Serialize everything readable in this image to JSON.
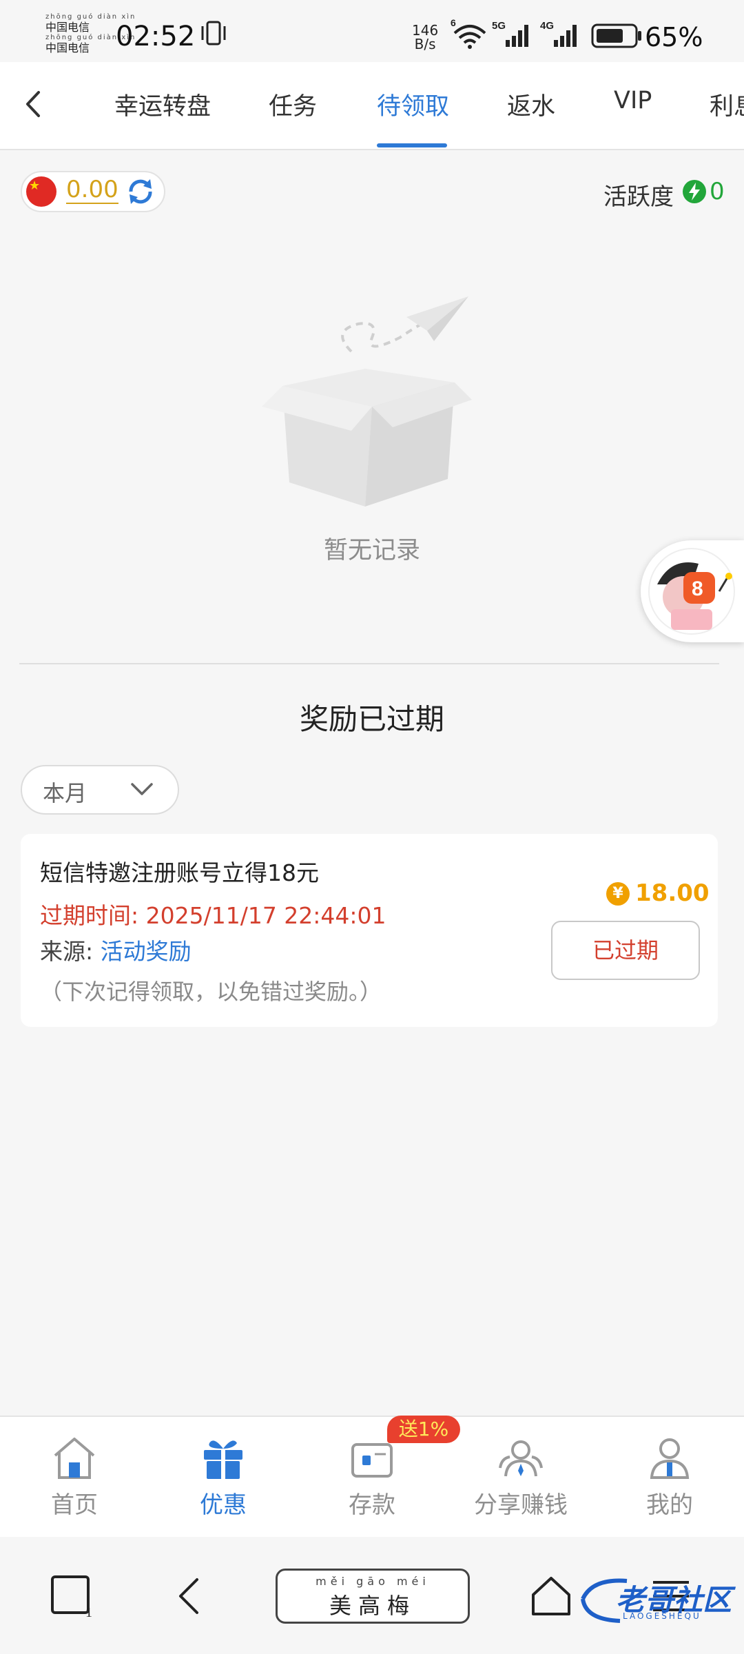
{
  "status_bar": {
    "carrier_pinyin": "zhōng guó diàn xìn",
    "carrier_line1": "中国电信",
    "carrier_line2": "中国电信",
    "time": "02:52",
    "net_speed_value": "146",
    "net_speed_unit": "B/s",
    "battery_pct": "65%"
  },
  "tabs": [
    {
      "label": "幸运转盘"
    },
    {
      "label": "任务"
    },
    {
      "label": "待领取"
    },
    {
      "label": "返水"
    },
    {
      "label": "VIP"
    },
    {
      "label": "利息"
    }
  ],
  "balance": {
    "value": "0.00"
  },
  "activity": {
    "label": "活跃度",
    "value": "0"
  },
  "empty_state": {
    "text": "暂无记录"
  },
  "expired_section": {
    "title": "奖励已过期",
    "filter": "本月"
  },
  "reward_card": {
    "title": "短信特邀注册账号立得18元",
    "expire_label": "过期时间: 2025/11/17 22:44:01",
    "source_label": "来源: ",
    "source_value": "活动奖励",
    "note": "（下次记得领取，以免错过奖励。）",
    "currency_symbol": "¥",
    "amount": "18.00",
    "status_button": "已过期"
  },
  "bottom_nav": [
    {
      "label": "首页",
      "icon": "home-icon"
    },
    {
      "label": "优惠",
      "icon": "gift-icon"
    },
    {
      "label": "存款",
      "icon": "wallet-icon"
    },
    {
      "label": "分享赚钱",
      "icon": "share-users-icon"
    },
    {
      "label": "我的",
      "icon": "user-icon"
    }
  ],
  "deposit_badge": "送1%",
  "system_nav": {
    "recent_count": "1",
    "ime_pinyin": "měi gāo méi",
    "ime_text": "美高梅"
  },
  "watermark": {
    "text": "老哥社区",
    "sub": "LAOGESHEQU"
  },
  "colors": {
    "accent": "#2e7ad6",
    "expired_red": "#d33f2d",
    "gold": "#f0a000",
    "activity_green": "#22a63a"
  }
}
